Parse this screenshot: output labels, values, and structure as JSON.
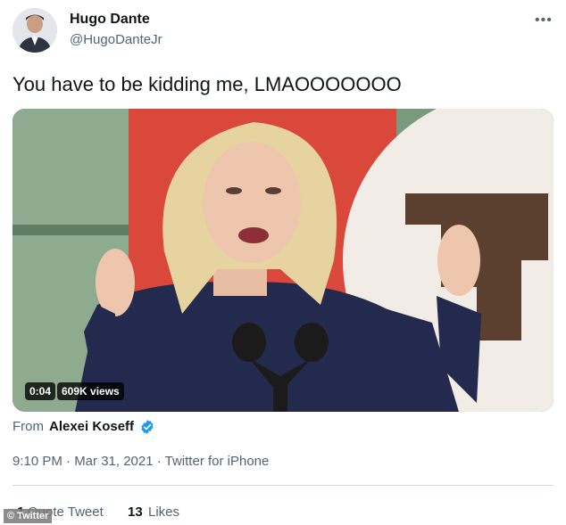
{
  "author": {
    "name": "Hugo Dante",
    "handle": "@HugoDanteJr"
  },
  "more_icon": "more-horizontal-icon",
  "more_glyph": "•••",
  "tweet": {
    "text": "You have to be kidding me, LMAOOOOOOO"
  },
  "video": {
    "duration": "0:04",
    "views": "609K views"
  },
  "attribution": {
    "from_label": "From",
    "name": "Alexei Koseff",
    "verified_icon": "verified-badge-icon",
    "verified_color": "#1d9bf0"
  },
  "meta": {
    "time": "9:10 PM",
    "separator": "·",
    "date": "Mar 31, 2021",
    "source": "Twitter for iPhone",
    "full": "9:10 PM · Mar 31, 2021 · Twitter for iPhone"
  },
  "stats": {
    "quote_count": "1",
    "quote_label": "Quote Tweet",
    "like_count": "13",
    "like_label": "Likes"
  },
  "watermark": "© Twitter"
}
